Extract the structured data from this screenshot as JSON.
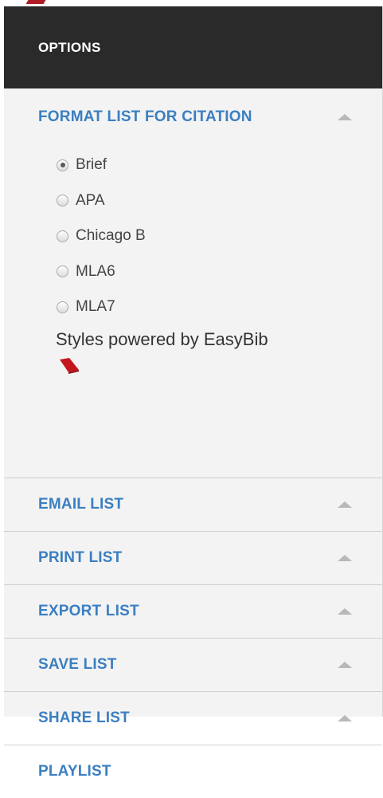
{
  "header": {
    "title": "OPTIONS"
  },
  "format": {
    "title": "FORMAT LIST FOR CITATION",
    "options": [
      {
        "label": "Brief",
        "checked": true
      },
      {
        "label": "APA",
        "checked": false
      },
      {
        "label": "Chicago B",
        "checked": false
      },
      {
        "label": "MLA6",
        "checked": false
      },
      {
        "label": "MLA7",
        "checked": false
      }
    ],
    "powered_by": "Styles powered by EasyBib",
    "logo_icon": "easybib-logo"
  },
  "sections": [
    {
      "title": "EMAIL LIST"
    },
    {
      "title": "PRINT LIST"
    },
    {
      "title": "EXPORT LIST"
    },
    {
      "title": "SAVE LIST"
    },
    {
      "title": "SHARE LIST"
    },
    {
      "title": "PLAYLIST"
    }
  ],
  "colors": {
    "header_bg": "#2a2a2a",
    "link_blue": "#3a7fc1",
    "panel_bg": "#f3f3f3",
    "logo_red": "#c4161c"
  }
}
